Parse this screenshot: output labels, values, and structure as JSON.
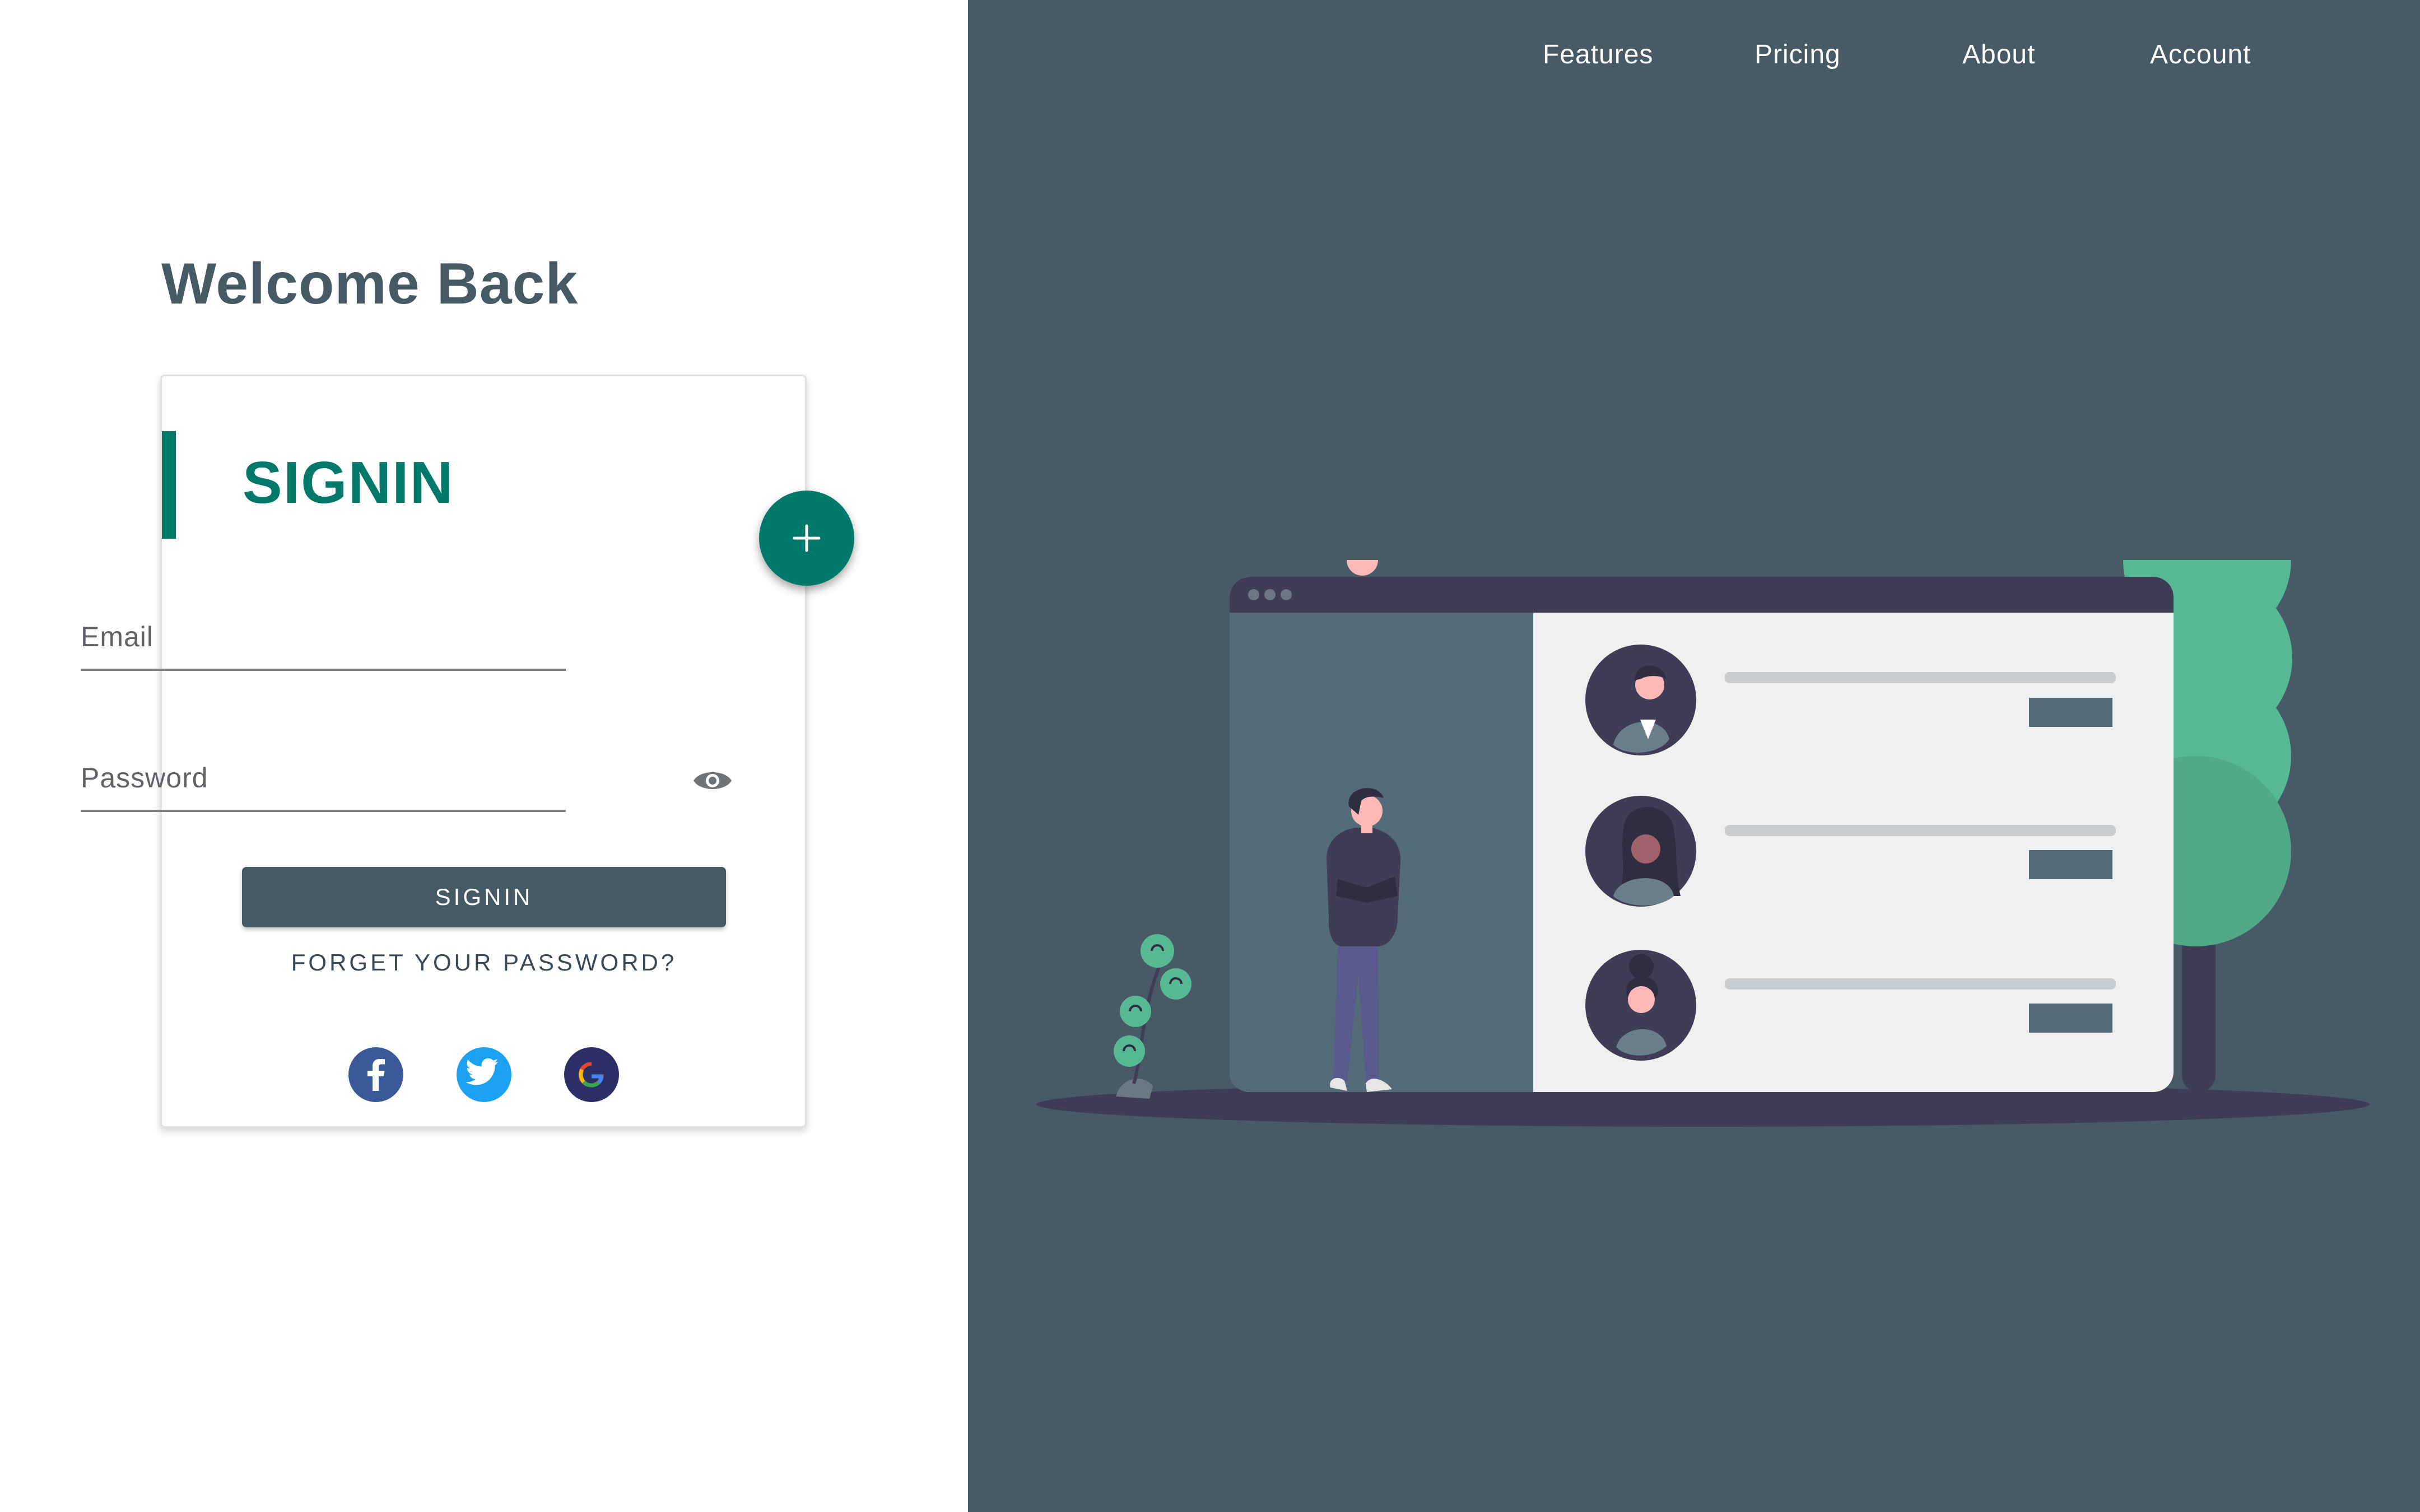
{
  "nav": {
    "links": [
      "Features",
      "Pricing",
      "About",
      "Account"
    ]
  },
  "page": {
    "welcome": "Welcome Back"
  },
  "signin_card": {
    "title": "SIGNIN",
    "email_placeholder": "Email",
    "password_placeholder": "Password",
    "submit_label": "SIGNIN",
    "forgot_label": "FORGET YOUR PASSWORD?"
  },
  "social": [
    "facebook-icon",
    "twitter-icon",
    "google-icon"
  ],
  "fab_icon": "plus-icon",
  "colors": {
    "accent": "#00796b",
    "panel": "#475a66",
    "button": "#455a64",
    "facebook": "#3b5998",
    "twitter": "#1da1f2",
    "google": "#2b2f66",
    "illustration_green": "#57b894"
  }
}
